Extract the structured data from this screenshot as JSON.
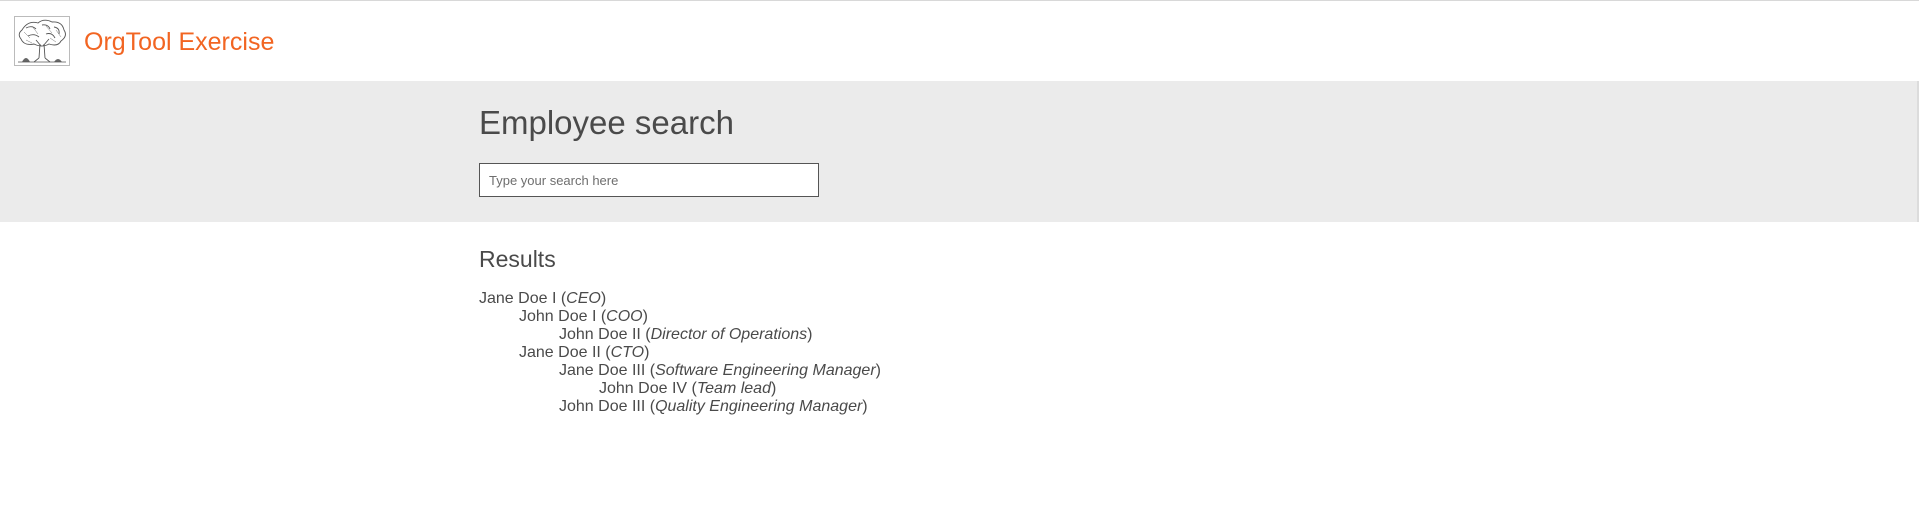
{
  "header": {
    "app_title": "OrgTool Exercise",
    "logo_icon": "tree-logo-icon",
    "accent_color": "#f26522"
  },
  "search": {
    "title": "Employee search",
    "placeholder": "Type your search here",
    "value": ""
  },
  "results": {
    "title": "Results",
    "items": [
      {
        "name": "Jane Doe I",
        "role": "CEO",
        "level": 0
      },
      {
        "name": "John Doe I",
        "role": "COO",
        "level": 1
      },
      {
        "name": "John Doe II",
        "role": "Director of Operations",
        "level": 2
      },
      {
        "name": "Jane Doe II",
        "role": "CTO",
        "level": 1
      },
      {
        "name": "Jane Doe III",
        "role": "Software Engineering Manager",
        "level": 2
      },
      {
        "name": "John Doe IV",
        "role": "Team lead",
        "level": 3
      },
      {
        "name": "John Doe III",
        "role": "Quality Engineering Manager",
        "level": 2
      }
    ]
  }
}
